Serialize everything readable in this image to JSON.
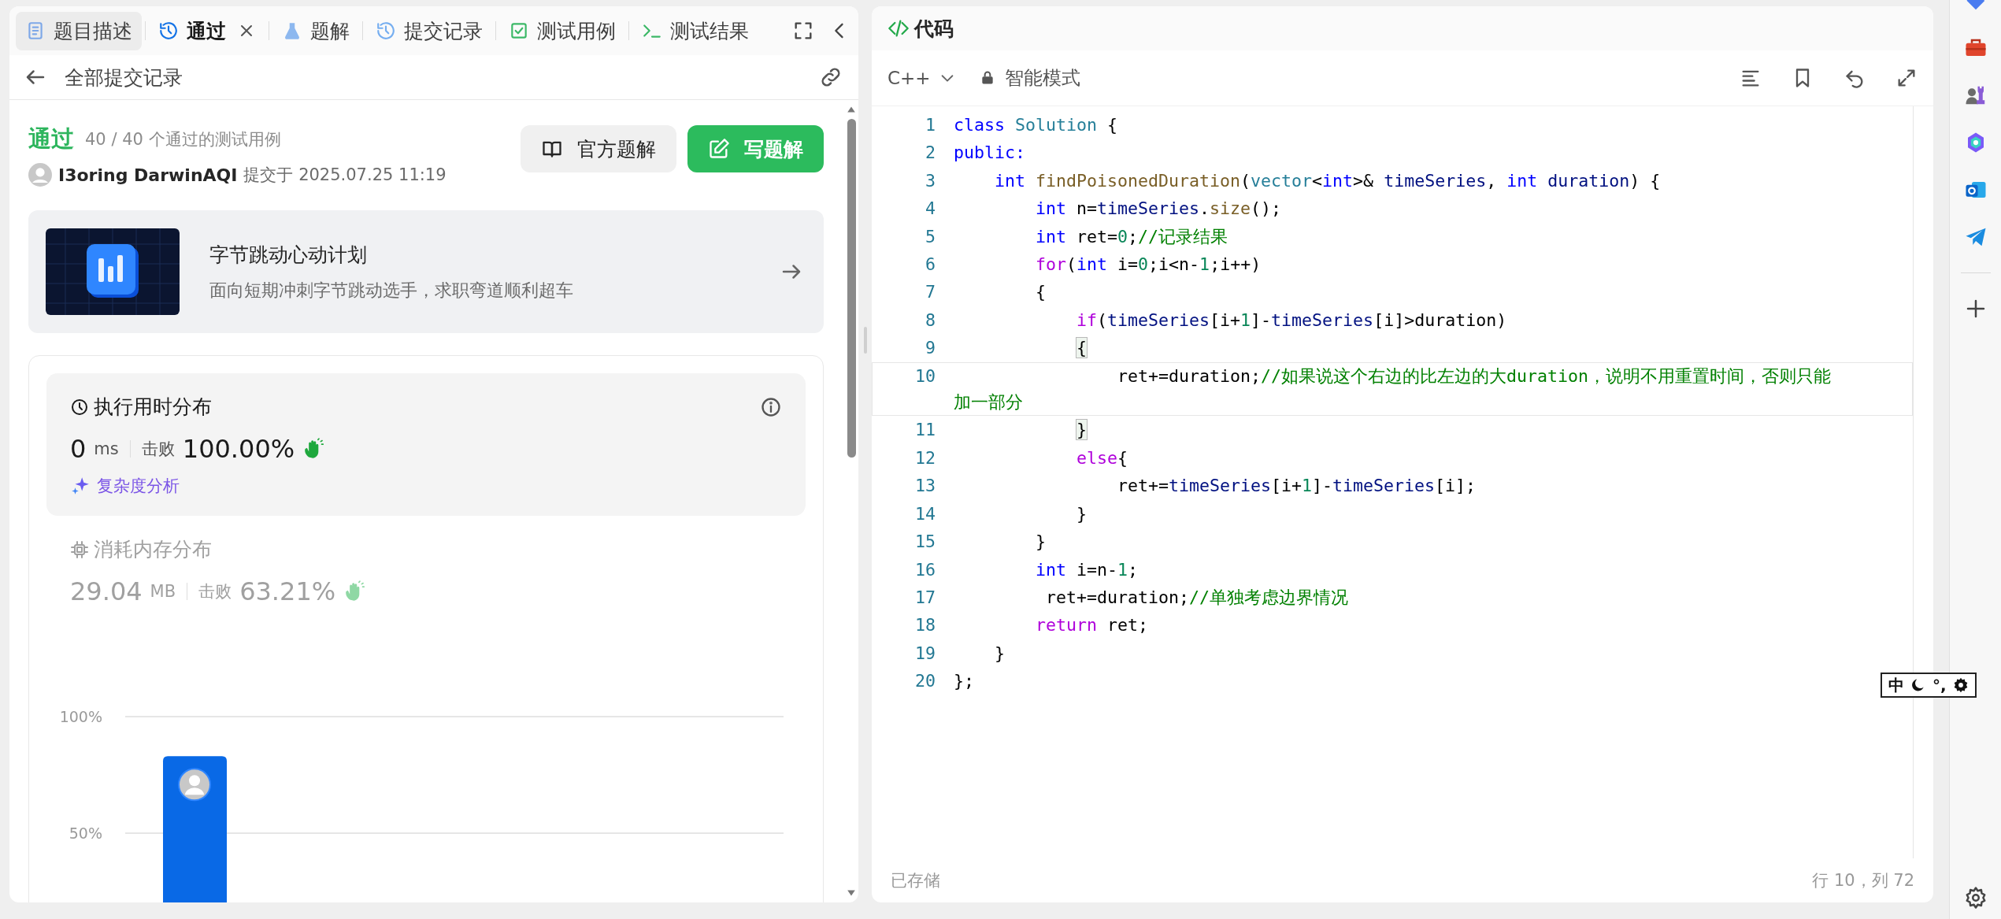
{
  "left_panel": {
    "tabs": [
      {
        "kind": "description",
        "label": "题目描述",
        "selected": false,
        "hovered": true,
        "closable": false
      },
      {
        "kind": "submission",
        "label": "通过",
        "selected": true,
        "hovered": false,
        "closable": true
      },
      {
        "kind": "solutions",
        "label": "题解",
        "selected": false,
        "hovered": false,
        "closable": false
      },
      {
        "kind": "history",
        "label": "提交记录",
        "selected": false,
        "hovered": false,
        "closable": false
      },
      {
        "kind": "testcase",
        "label": "测试用例",
        "selected": false,
        "hovered": false,
        "closable": false
      },
      {
        "kind": "result",
        "label": "测试结果",
        "selected": false,
        "hovered": false,
        "closable": false
      }
    ],
    "header": {
      "title": "全部提交记录"
    },
    "result": {
      "status": "通过",
      "summary": "40 / 40 个通过的测试用例",
      "author": "I3oring DarwinAQI",
      "submitted": "提交于 2025.07.25 11:19"
    },
    "buttons": [
      {
        "kind": "secondary",
        "label": "官方题解"
      },
      {
        "kind": "primary",
        "label": "写题解"
      }
    ],
    "promo": {
      "title": "字节跳动心动计划",
      "subtitle": "面向短期冲刺字节跳动选手，求职弯道顺利超车"
    },
    "distributions": [
      {
        "kind": "time",
        "title": "执行用时分布",
        "value": "0",
        "unit": "ms",
        "beats_label": "击败",
        "beats": "100.00%",
        "link": "复杂度分析",
        "selected": true
      },
      {
        "kind": "memory",
        "title": "消耗内存分布",
        "value": "29.04",
        "unit": "MB",
        "beats_label": "击败",
        "beats": "63.21%",
        "selected": false
      }
    ],
    "chart_data": {
      "type": "bar",
      "ylim": [
        0,
        100
      ],
      "yticks": [
        {
          "value": 50,
          "label": "50%"
        },
        {
          "value": 100,
          "label": "100%"
        }
      ],
      "values": [
        83
      ]
    }
  },
  "editor": {
    "title": "代码",
    "language": "C++",
    "mode": "智能模式",
    "lines": [
      {
        "number": "1",
        "current": false,
        "tokens": [
          {
            "kind": "kw",
            "text": "class"
          },
          {
            "kind": "type",
            "text": " Solution"
          },
          {
            "kind": "p",
            "text": " {"
          }
        ]
      },
      {
        "number": "2",
        "current": false,
        "tokens": [
          {
            "kind": "kw",
            "text": "public:"
          }
        ]
      },
      {
        "number": "3",
        "current": false,
        "tokens": [
          {
            "kind": "kw",
            "text": "    int"
          },
          {
            "kind": "fn",
            "text": " findPoisonedDuration"
          },
          {
            "kind": "p",
            "text": "("
          },
          {
            "kind": "type",
            "text": "vector"
          },
          {
            "kind": "p",
            "text": "<"
          },
          {
            "kind": "kw",
            "text": "int"
          },
          {
            "kind": "p",
            "text": ">& "
          },
          {
            "kind": "var",
            "text": "timeSeries"
          },
          {
            "kind": "p",
            "text": ", "
          },
          {
            "kind": "kw",
            "text": "int"
          },
          {
            "kind": "var",
            "text": " duration"
          },
          {
            "kind": "p",
            "text": ") {"
          }
        ]
      },
      {
        "number": "4",
        "current": false,
        "tokens": [
          {
            "kind": "kw",
            "text": "        int"
          },
          {
            "kind": "p",
            "text": " n="
          },
          {
            "kind": "var",
            "text": "timeSeries"
          },
          {
            "kind": "p",
            "text": "."
          },
          {
            "kind": "fn",
            "text": "size"
          },
          {
            "kind": "p",
            "text": "();"
          }
        ]
      },
      {
        "number": "5",
        "current": false,
        "tokens": [
          {
            "kind": "kw",
            "text": "        int"
          },
          {
            "kind": "p",
            "text": " ret="
          },
          {
            "kind": "num",
            "text": "0"
          },
          {
            "kind": "p",
            "text": ";"
          },
          {
            "kind": "cm",
            "text": "//记录结果"
          }
        ]
      },
      {
        "number": "6",
        "current": false,
        "tokens": [
          {
            "kind": "ctrl",
            "text": "        for"
          },
          {
            "kind": "p",
            "text": "("
          },
          {
            "kind": "kw",
            "text": "int"
          },
          {
            "kind": "p",
            "text": " i="
          },
          {
            "kind": "num",
            "text": "0"
          },
          {
            "kind": "p",
            "text": ";i<n-"
          },
          {
            "kind": "num",
            "text": "1"
          },
          {
            "kind": "p",
            "text": ";i++)"
          }
        ]
      },
      {
        "number": "7",
        "current": false,
        "tokens": [
          {
            "kind": "p",
            "text": "        {"
          }
        ]
      },
      {
        "number": "8",
        "current": false,
        "tokens": [
          {
            "kind": "ctrl",
            "text": "            if"
          },
          {
            "kind": "p",
            "text": "("
          },
          {
            "kind": "var",
            "text": "timeSeries"
          },
          {
            "kind": "p",
            "text": "[i+"
          },
          {
            "kind": "num",
            "text": "1"
          },
          {
            "kind": "p",
            "text": "]-"
          },
          {
            "kind": "var",
            "text": "timeSeries"
          },
          {
            "kind": "p",
            "text": "[i]>duration)"
          }
        ]
      },
      {
        "number": "9",
        "current": false,
        "tokens": [
          {
            "kind": "match",
            "text": "            {"
          }
        ]
      },
      {
        "number": "10",
        "current": true,
        "tokens": [
          {
            "kind": "p",
            "text": "                ret+=duration;"
          },
          {
            "kind": "cm",
            "text": "//如果说这个右边的比左边的大duration，说明不用重置时间，否则只能加一部分"
          }
        ]
      },
      {
        "number": "11",
        "current": false,
        "tokens": [
          {
            "kind": "match",
            "text": "            }"
          }
        ]
      },
      {
        "number": "12",
        "current": false,
        "tokens": [
          {
            "kind": "ctrl",
            "text": "            else"
          },
          {
            "kind": "p",
            "text": "{"
          }
        ]
      },
      {
        "number": "13",
        "current": false,
        "tokens": [
          {
            "kind": "p",
            "text": "                ret+="
          },
          {
            "kind": "var",
            "text": "timeSeries"
          },
          {
            "kind": "p",
            "text": "[i+"
          },
          {
            "kind": "num",
            "text": "1"
          },
          {
            "kind": "p",
            "text": "]-"
          },
          {
            "kind": "var",
            "text": "timeSeries"
          },
          {
            "kind": "p",
            "text": "[i];"
          }
        ]
      },
      {
        "number": "14",
        "current": false,
        "tokens": [
          {
            "kind": "p",
            "text": "            }"
          }
        ]
      },
      {
        "number": "15",
        "current": false,
        "tokens": [
          {
            "kind": "p",
            "text": "        }"
          }
        ]
      },
      {
        "number": "16",
        "current": false,
        "tokens": [
          {
            "kind": "kw",
            "text": "        int"
          },
          {
            "kind": "p",
            "text": " i=n-"
          },
          {
            "kind": "num",
            "text": "1"
          },
          {
            "kind": "p",
            "text": ";"
          }
        ]
      },
      {
        "number": "17",
        "current": false,
        "tokens": [
          {
            "kind": "p",
            "text": "         ret+=duration;"
          },
          {
            "kind": "cm",
            "text": "//单独考虑边界情况"
          }
        ]
      },
      {
        "number": "18",
        "current": false,
        "tokens": [
          {
            "kind": "ctrl",
            "text": "        return"
          },
          {
            "kind": "p",
            "text": " ret;"
          }
        ]
      },
      {
        "number": "19",
        "current": false,
        "tokens": [
          {
            "kind": "p",
            "text": "    }"
          }
        ]
      },
      {
        "number": "20",
        "current": false,
        "tokens": [
          {
            "kind": "p",
            "text": "};"
          }
        ]
      }
    ],
    "status": "已存储",
    "cursor": "行 10，列 72"
  },
  "ime_bar": {
    "mode": "中",
    "punctuation": "°,"
  }
}
